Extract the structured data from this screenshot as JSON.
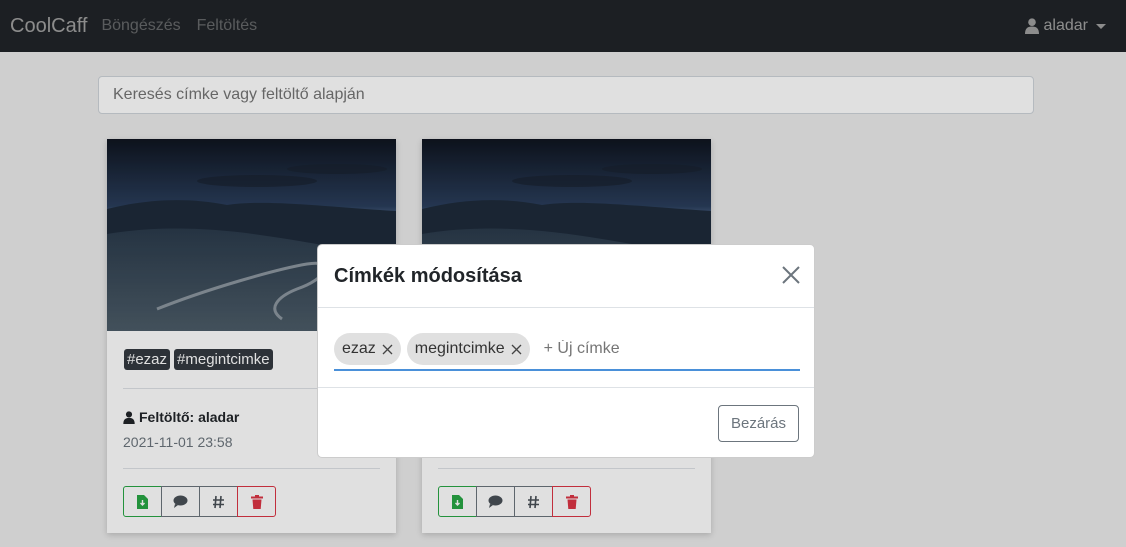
{
  "navbar": {
    "brand": "CoolCaff",
    "links": [
      "Böngészés",
      "Feltöltés"
    ],
    "user": "aladar"
  },
  "search": {
    "placeholder": "Keresés címke vagy feltöltő alapján"
  },
  "cards": [
    {
      "tags": [
        "#ezaz",
        "#megintcimke"
      ],
      "uploader": "Feltöltő: aladar",
      "date": "2021-11-01 23:58"
    },
    {
      "tags": [],
      "uploader": "",
      "date": ""
    }
  ],
  "icons": {
    "download": "file-download-icon",
    "comment": "comment-icon",
    "tag": "hash-icon",
    "delete": "trash-icon",
    "user": "user-icon",
    "close": "close-icon"
  },
  "colors": {
    "navbar": "#343a40",
    "success": "#28a745",
    "danger": "#dc3545",
    "accent": "#4a90d9"
  },
  "modal": {
    "title": "Címkék módosítása",
    "chips": [
      "ezaz",
      "megintcimke"
    ],
    "new_tag_placeholder": "+ Új címke",
    "close_label": "Bezárás"
  }
}
